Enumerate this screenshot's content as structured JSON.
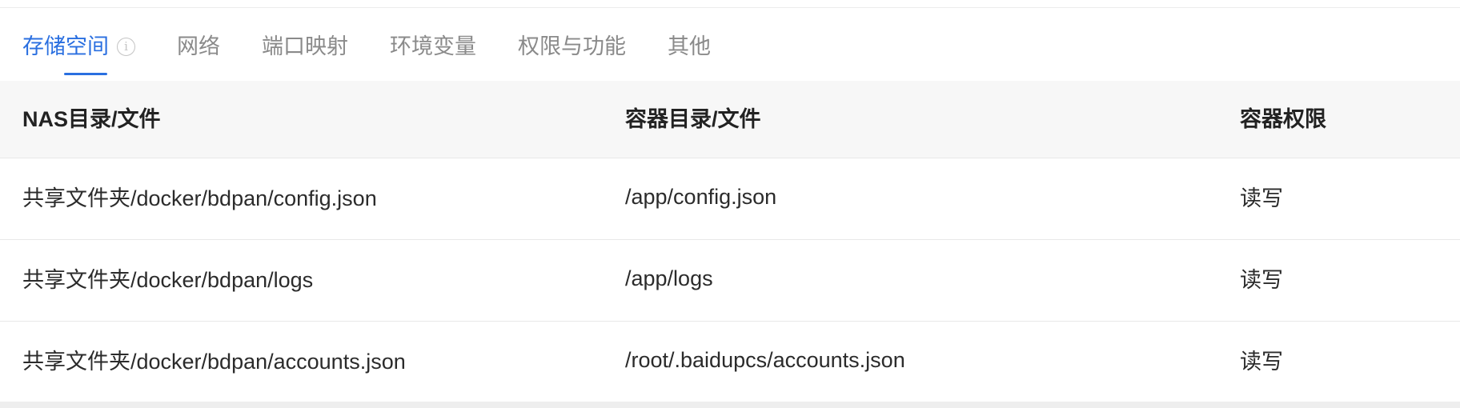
{
  "tabs": [
    {
      "label": "存储空间",
      "active": true
    },
    {
      "label": "网络",
      "active": false
    },
    {
      "label": "端口映射",
      "active": false
    },
    {
      "label": "环境变量",
      "active": false
    },
    {
      "label": "权限与功能",
      "active": false
    },
    {
      "label": "其他",
      "active": false
    }
  ],
  "icons": {
    "info": "info-circle-icon"
  },
  "colors": {
    "accent": "#2a6fe0",
    "tab_inactive": "#8a8a8a",
    "header_bg": "#f7f7f7"
  },
  "table": {
    "columns": [
      "NAS目录/文件",
      "容器目录/文件",
      "容器权限"
    ],
    "rows": [
      {
        "nas_path": "共享文件夹/docker/bdpan/config.json",
        "container_path": "/app/config.json",
        "permission": "读写"
      },
      {
        "nas_path": "共享文件夹/docker/bdpan/logs",
        "container_path": "/app/logs",
        "permission": "读写"
      },
      {
        "nas_path": "共享文件夹/docker/bdpan/accounts.json",
        "container_path": "/root/.baidupcs/accounts.json",
        "permission": "读写"
      }
    ]
  }
}
